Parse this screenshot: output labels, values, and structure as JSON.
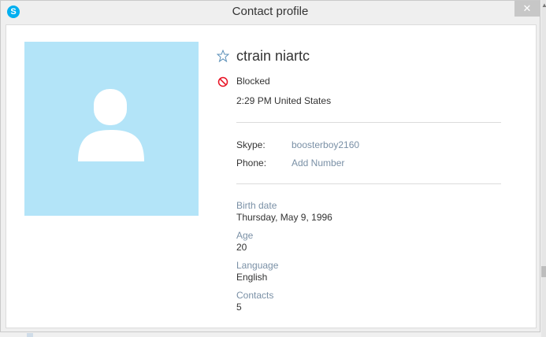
{
  "window": {
    "title": "Contact profile",
    "close_label": "✕"
  },
  "colors": {
    "avatar_bg": "#b3e4f8",
    "accent": "#00aff0",
    "blocked": "#e81123",
    "link": "#7a90a6"
  },
  "profile": {
    "name": "ctrain niartc",
    "status": "Blocked",
    "local_time": "2:29 PM United States"
  },
  "contact_rows": [
    {
      "label": "Skype:",
      "value": "boosterboy2160"
    },
    {
      "label": "Phone:",
      "value": "Add Number"
    }
  ],
  "fields": [
    {
      "label": "Birth date",
      "value": "Thursday, May 9, 1996"
    },
    {
      "label": "Age",
      "value": "20"
    },
    {
      "label": "Language",
      "value": "English"
    },
    {
      "label": "Contacts",
      "value": "5"
    }
  ]
}
